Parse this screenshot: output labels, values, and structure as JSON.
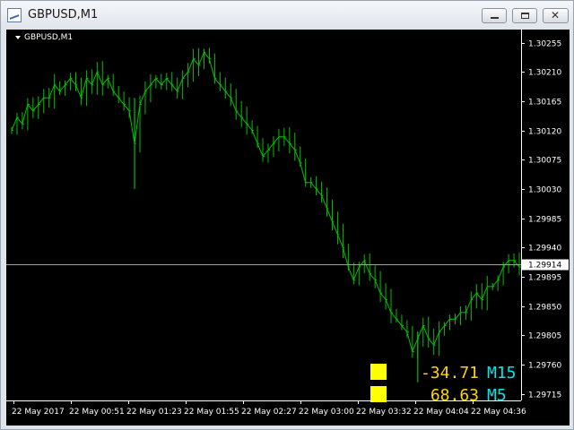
{
  "window": {
    "title": "GBPUSD,M1"
  },
  "chart": {
    "symbol_label": "GBPUSD,M1",
    "current_price": "1.29914",
    "colors": {
      "background": "#000000",
      "candle": "#00c000",
      "axis": "#ffffff",
      "ask_line": "#a0a0a0",
      "indicator_value": "#ffd700",
      "indicator_tf": "#00e5e5",
      "square": "#ffff00"
    },
    "indicators": [
      {
        "value": "-34.71",
        "timeframe": "M15"
      },
      {
        "value": "68.63",
        "timeframe": "M5"
      }
    ]
  },
  "chart_data": {
    "type": "line",
    "ylim": [
      1.29705,
      1.30275
    ],
    "y_ticks": [
      "1.30255",
      "1.30210",
      "1.30165",
      "1.30120",
      "1.30075",
      "1.30030",
      "1.29985",
      "1.29940",
      "1.29895",
      "1.29850",
      "1.29805",
      "1.29760",
      "1.29715"
    ],
    "x_ticks": [
      "22 May 2017",
      "22 May 00:51",
      "22 May 01:23",
      "22 May 01:55",
      "22 May 02:27",
      "22 May 03:00",
      "22 May 03:32",
      "22 May 04:04",
      "22 May 04:36"
    ],
    "series": [
      {
        "values": [
          1.3012,
          1.3014,
          1.3013,
          1.3016,
          1.3015,
          1.3016,
          1.3017,
          1.3017,
          1.3019,
          1.3018,
          1.3019,
          1.302,
          1.3019,
          1.3017,
          1.302,
          1.3019,
          1.3021,
          1.3019,
          1.302,
          1.3018,
          1.3017,
          1.3016,
          1.3015,
          1.301,
          1.3016,
          1.3018,
          1.3019,
          1.302,
          1.3019,
          1.302,
          1.3019,
          1.3018,
          1.302,
          1.3021,
          1.3023,
          1.3022,
          1.3024,
          1.3023,
          1.302,
          1.3019,
          1.3018,
          1.3017,
          1.3015,
          1.3014,
          1.3013,
          1.3012,
          1.301,
          1.3008,
          1.3009,
          1.301,
          1.3011,
          1.3011,
          1.301,
          1.3009,
          1.3007,
          1.3004,
          1.3004,
          1.3003,
          1.3002,
          1.3,
          1.2998,
          1.2996,
          1.2994,
          1.2991,
          1.2989,
          1.2991,
          1.2992,
          1.299,
          1.2989,
          1.2987,
          1.2986,
          1.2984,
          1.2983,
          1.2982,
          1.2981,
          1.2978,
          1.298,
          1.2982,
          1.298,
          1.2979,
          1.2981,
          1.2982,
          1.2983,
          1.2983,
          1.2984,
          1.2984,
          1.2986,
          1.2987,
          1.2986,
          1.2988,
          1.2988,
          1.2989,
          1.2991,
          1.2992,
          1.2992,
          1.2991
        ]
      }
    ],
    "current_price": 1.29914
  }
}
